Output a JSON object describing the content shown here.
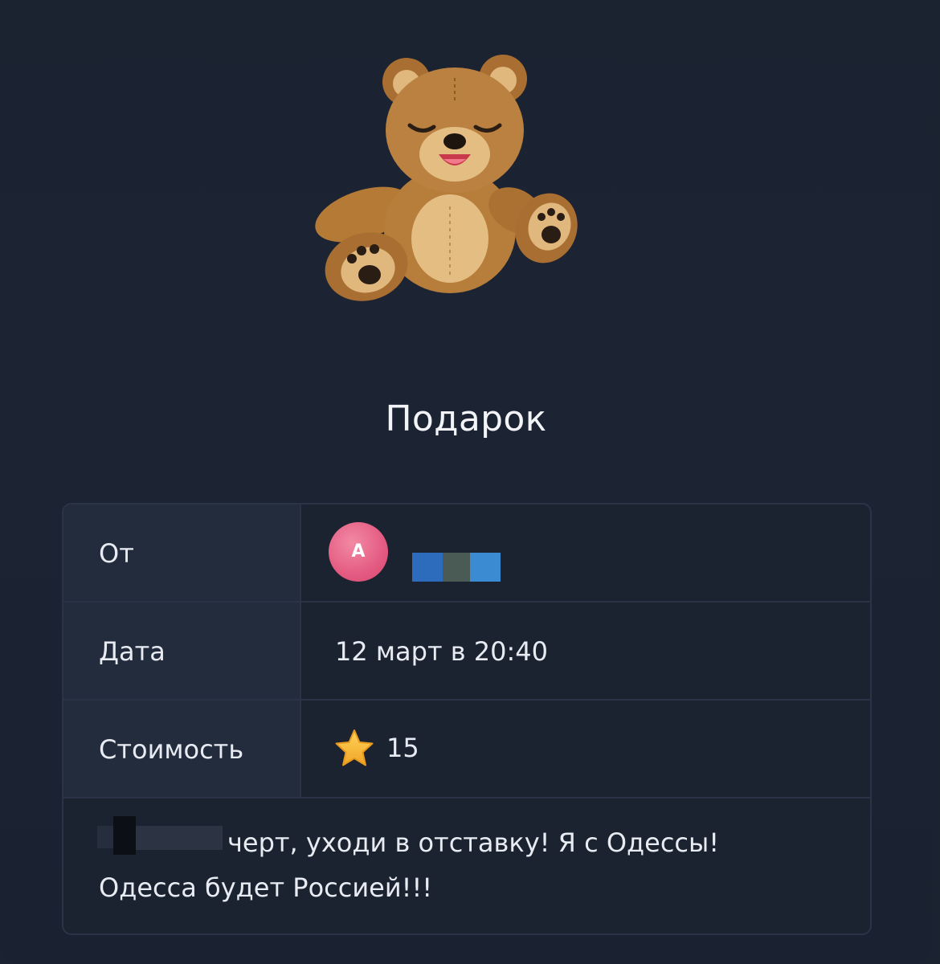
{
  "gift": {
    "sticker_icon": "teddy-bear-icon",
    "title": "Подарок"
  },
  "details": {
    "from": {
      "label": "От",
      "avatar_letter": "A",
      "avatar_color": "#e45b82"
    },
    "date": {
      "label": "Дата",
      "value": "12 март в 20:40"
    },
    "cost": {
      "label": "Стоимость",
      "icon": "star-icon",
      "value": "15"
    }
  },
  "message": {
    "line1": "черт, уходи в отставку! Я с Одессы!",
    "line2": "Одесса будет Россией!!!"
  }
}
